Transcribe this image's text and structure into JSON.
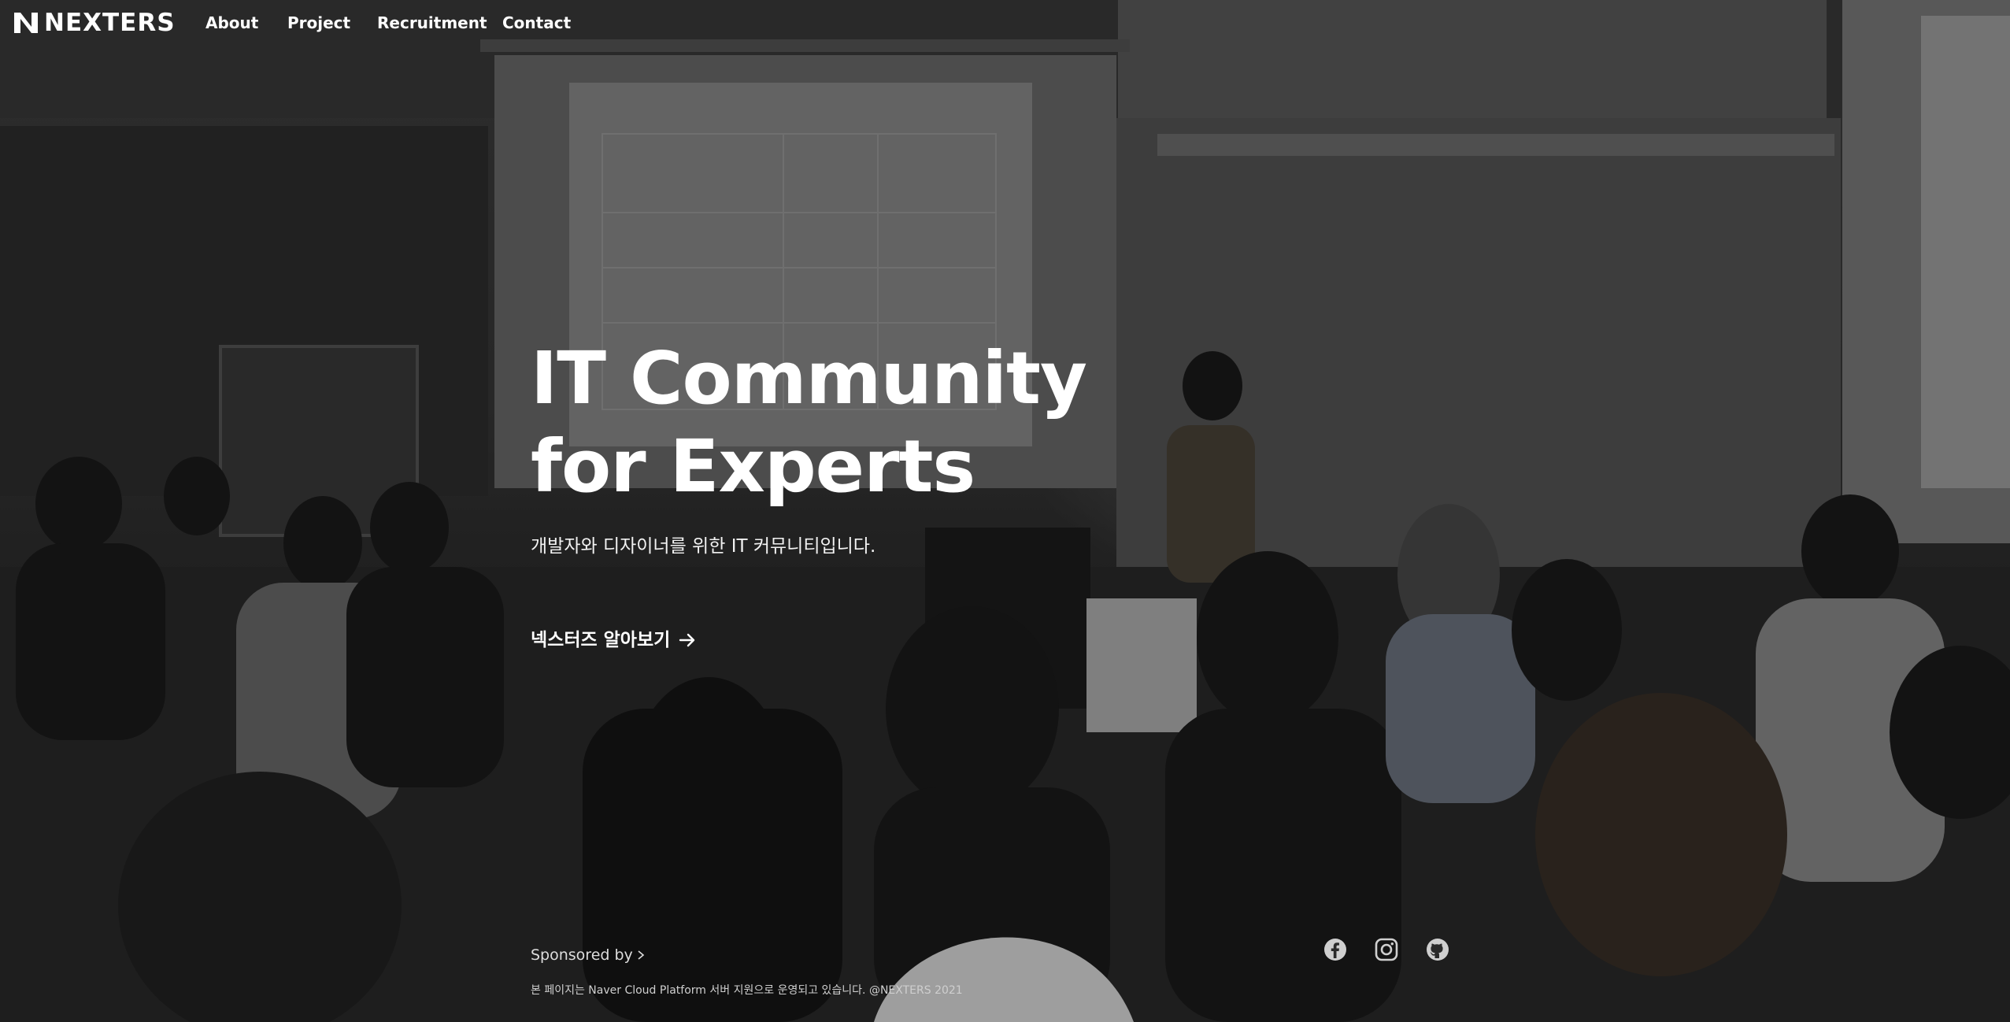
{
  "brand": {
    "name": "NEXTERS"
  },
  "nav": {
    "items": [
      {
        "label": "About"
      },
      {
        "label": "Project"
      },
      {
        "label": "Recruitment"
      },
      {
        "label": "Contact"
      }
    ]
  },
  "hero": {
    "title_line1": "IT Community",
    "title_line2": "for Experts",
    "subtitle": "개발자와 디자이너를 위한 IT 커뮤니티입니다.",
    "cta_label": "넥스터즈 알아보기",
    "cta_icon": "arrow-right-icon"
  },
  "footer": {
    "sponsored_label": "Sponsored by",
    "sponsored_icon": "chevron-right-icon",
    "note": "본 페이지는 Naver Cloud Platform 서버 지원으로 운영되고 있습니다. @NEXTERS 2021",
    "social": [
      {
        "name": "facebook-icon"
      },
      {
        "name": "instagram-icon"
      },
      {
        "name": "github-icon"
      }
    ]
  },
  "colors": {
    "text": "#ffffff",
    "overlay": "#000000"
  }
}
